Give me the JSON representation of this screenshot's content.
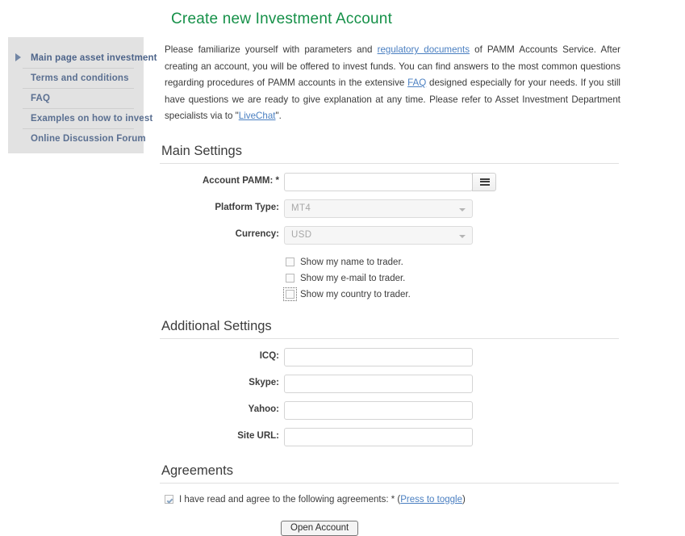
{
  "page": {
    "title": "Create new Investment Account"
  },
  "sidebar": {
    "items": [
      {
        "label": "Main page asset investment",
        "active": true
      },
      {
        "label": "Terms and conditions",
        "active": false
      },
      {
        "label": "FAQ",
        "active": false
      },
      {
        "label": "Examples on how to invest",
        "active": false
      },
      {
        "label": "Online Discussion Forum",
        "active": false
      }
    ]
  },
  "intro": {
    "part1": "Please familiarize yourself with parameters and ",
    "link1": "regulatory documents",
    "part2": " of PAMM Accounts Service. After creating an account, you will be offered to invest funds. You can find answers to the most common questions regarding procedures of PAMM accounts in the extensive ",
    "link2": "FAQ",
    "part3": " designed especially for your needs. If you still have questions we are ready to give explanation at any time. Please refer to Asset Investment Department specialists via to \"",
    "link3": "LiveChat",
    "part4": "\"."
  },
  "main_settings": {
    "heading": "Main Settings",
    "account_pamm": {
      "label": "Account PAMM:",
      "required_mark": "*",
      "value": "",
      "placeholder": ""
    },
    "platform_type": {
      "label": "Platform Type:",
      "value": "MT4",
      "options": [
        "MT4"
      ]
    },
    "currency": {
      "label": "Currency:",
      "value": "USD",
      "options": [
        "USD"
      ]
    },
    "checkboxes": [
      {
        "label": "Show my name to trader.",
        "checked": false,
        "focused": false
      },
      {
        "label": "Show my e-mail to trader.",
        "checked": false,
        "focused": false
      },
      {
        "label": "Show my country to trader.",
        "checked": false,
        "focused": true
      }
    ]
  },
  "additional_settings": {
    "heading": "Additional Settings",
    "fields": [
      {
        "label": "ICQ:",
        "value": "",
        "placeholder": ""
      },
      {
        "label": "Skype:",
        "value": "",
        "placeholder": ""
      },
      {
        "label": "Yahoo:",
        "value": "",
        "placeholder": ""
      },
      {
        "label": "Site URL:",
        "value": "",
        "placeholder": ""
      }
    ]
  },
  "agreements": {
    "heading": "Agreements",
    "checkbox_checked": true,
    "text_before": "I have read and agree to the following agreements: * (",
    "toggle_link": "Press to toggle",
    "text_after": ")"
  },
  "submit": {
    "label": "Open Account"
  },
  "colors": {
    "title_green": "#159048",
    "link_blue": "#4a7fc1",
    "sidebar_bg": "#e2e2e2",
    "sidebar_link": "#5a6f91"
  }
}
